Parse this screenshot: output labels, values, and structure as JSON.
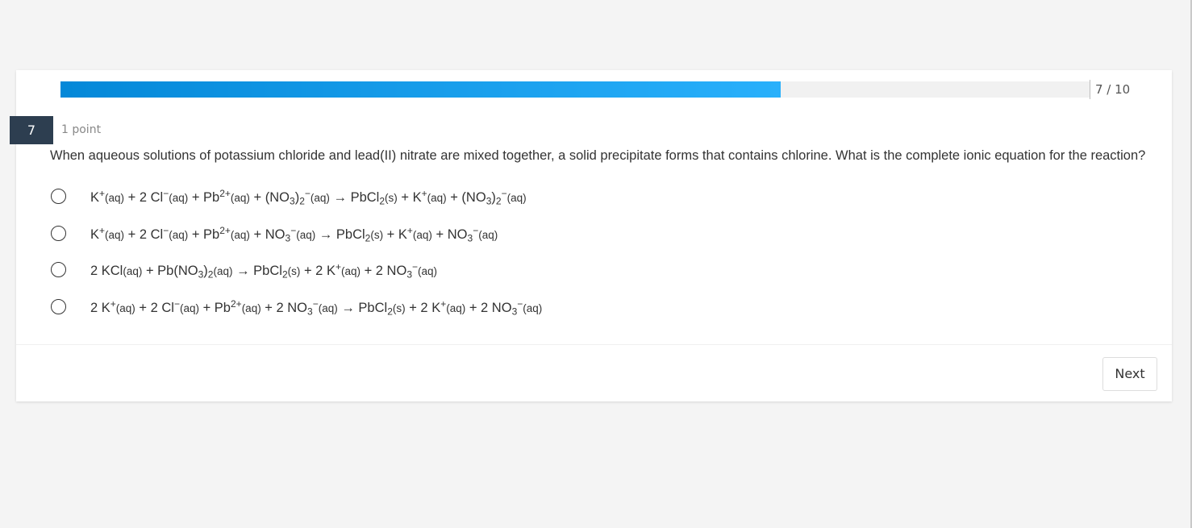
{
  "progress": {
    "text": "7 / 10",
    "fraction": 0.7
  },
  "question": {
    "number": "7",
    "points": "1 point",
    "text": "When aqueous solutions of potassium chloride and lead(II) nitrate are mixed together, a solid precipitate forms that contains chlorine. What is the complete ionic equation for the reaction?",
    "options": [
      "K⁺(aq) + 2 Cl⁻(aq) + Pb²⁺(aq) + (NO₃)₂⁻(aq) → PbCl₂(s) + K⁺(aq) + (NO₃)₂⁻(aq)",
      "K⁺(aq) + 2 Cl⁻(aq) + Pb²⁺(aq) + NO₃⁻(aq) → PbCl₂(s) + K⁺(aq) + NO₃⁻(aq)",
      "2 KCl(aq) + Pb(NO₃)₂(aq) → PbCl₂(s) + 2 K⁺(aq) + 2 NO₃⁻(aq)",
      "2 K⁺(aq) + 2 Cl⁻(aq) + Pb²⁺(aq) + 2 NO₃⁻(aq) → PbCl₂(s) + 2 K⁺(aq) + 2 NO₃⁻(aq)"
    ]
  },
  "buttons": {
    "next": "Next"
  },
  "colors": {
    "progress_start": "#0488d8",
    "progress_end": "#29b0fb",
    "badge": "#2d3e50"
  }
}
